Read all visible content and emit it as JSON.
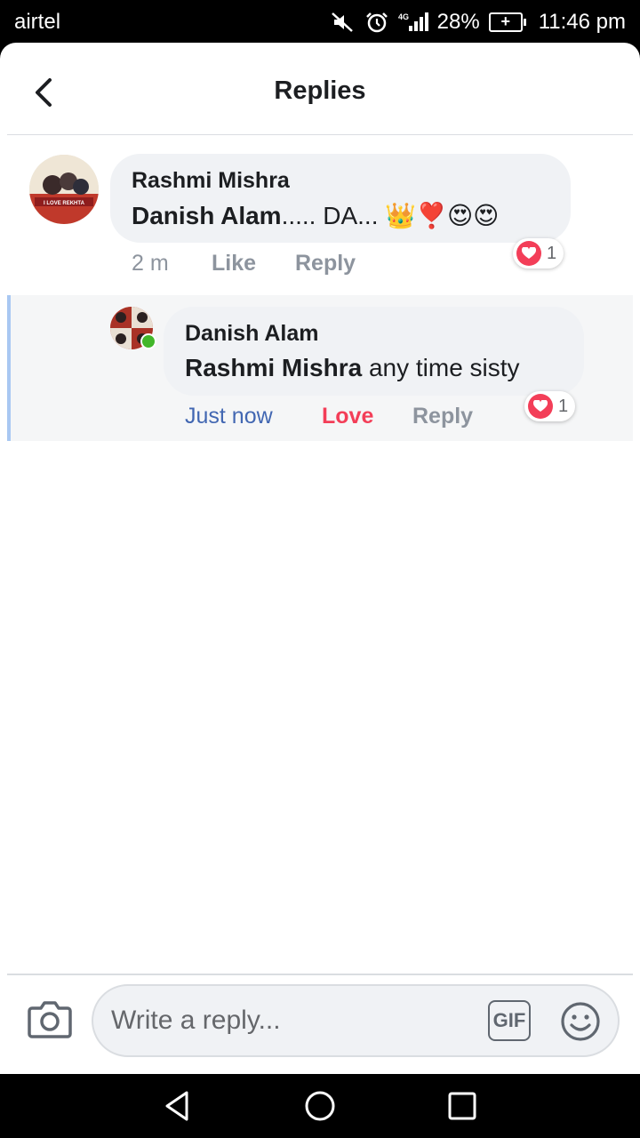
{
  "status_bar": {
    "carrier": "airtel",
    "battery_percent": "28%",
    "time": "11:46 pm",
    "network": "4G"
  },
  "header": {
    "title": "Replies"
  },
  "comment": {
    "author": "Rashmi Mishra",
    "mention": "Danish Alam",
    "text": "..... DA...",
    "emoji": "👑❣️😍😍",
    "time": "2 m",
    "like_label": "Like",
    "reply_label": "Reply",
    "reaction_count": "1",
    "avatar_caption": "I LOVE REKHTA"
  },
  "reply": {
    "author": "Danish Alam",
    "mention": "Rashmi Mishra",
    "text": " any time sisty",
    "time": "Just now",
    "love_label": "Love",
    "reply_label": "Reply",
    "reaction_count": "1"
  },
  "composer": {
    "placeholder": "Write a reply...",
    "gif_label": "GIF"
  },
  "colors": {
    "link_blue": "#4267b2",
    "love_red": "#f33e58",
    "meta_gray": "#8d949e",
    "bubble_bg": "#f0f2f5",
    "online_green": "#42b72a"
  }
}
